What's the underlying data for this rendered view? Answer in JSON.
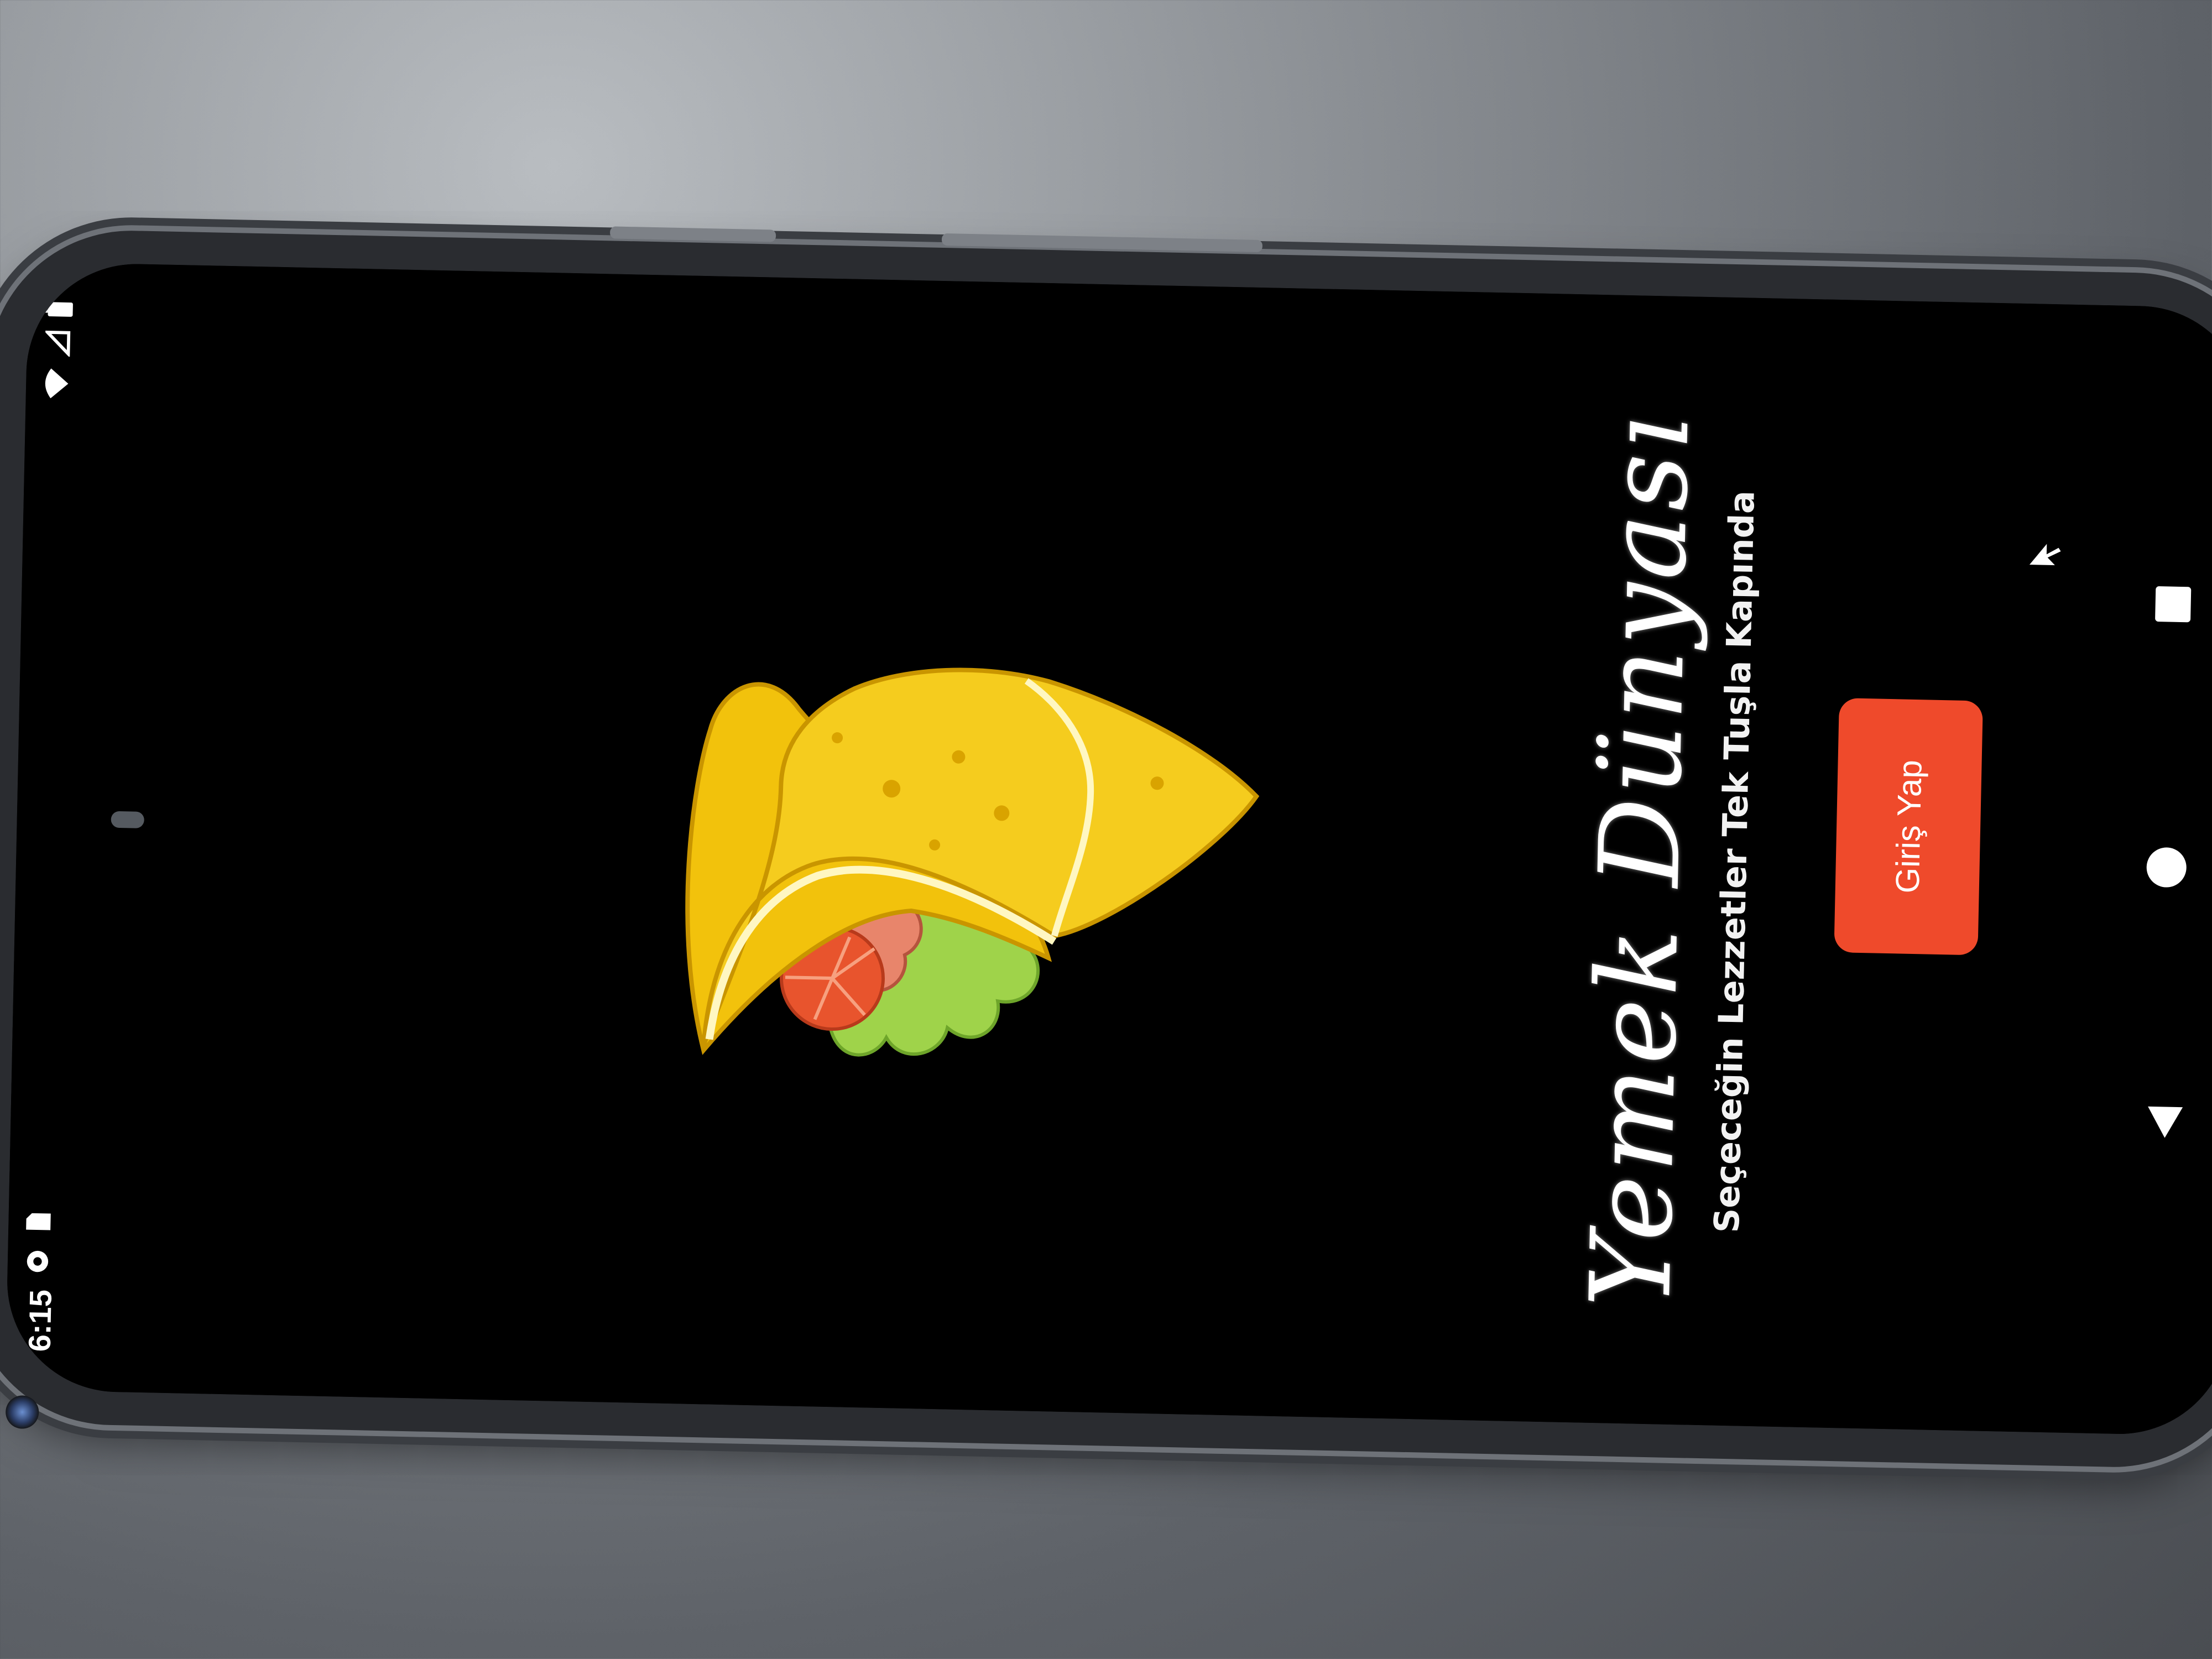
{
  "status_bar": {
    "time": "6:15",
    "left_icons": [
      "android-settings-icon",
      "sim-card-icon"
    ],
    "right_icons": [
      "wifi-icon",
      "signal-icon",
      "battery-icon"
    ]
  },
  "app": {
    "title": "Yemek Dünyası",
    "subtitle": "Seçeceğin Lezzetler Tek Tuşla Kapında",
    "hero_image": "wrap-sandwich-illustration",
    "login_button_label": "Giriş Yap"
  },
  "nav_bar": {
    "items": [
      "back-icon",
      "home-icon",
      "recents-icon"
    ]
  },
  "colors": {
    "screen_background": "#000000",
    "button_accent": "#ef4a2b",
    "wrap_yellow": "#f2c20c"
  }
}
